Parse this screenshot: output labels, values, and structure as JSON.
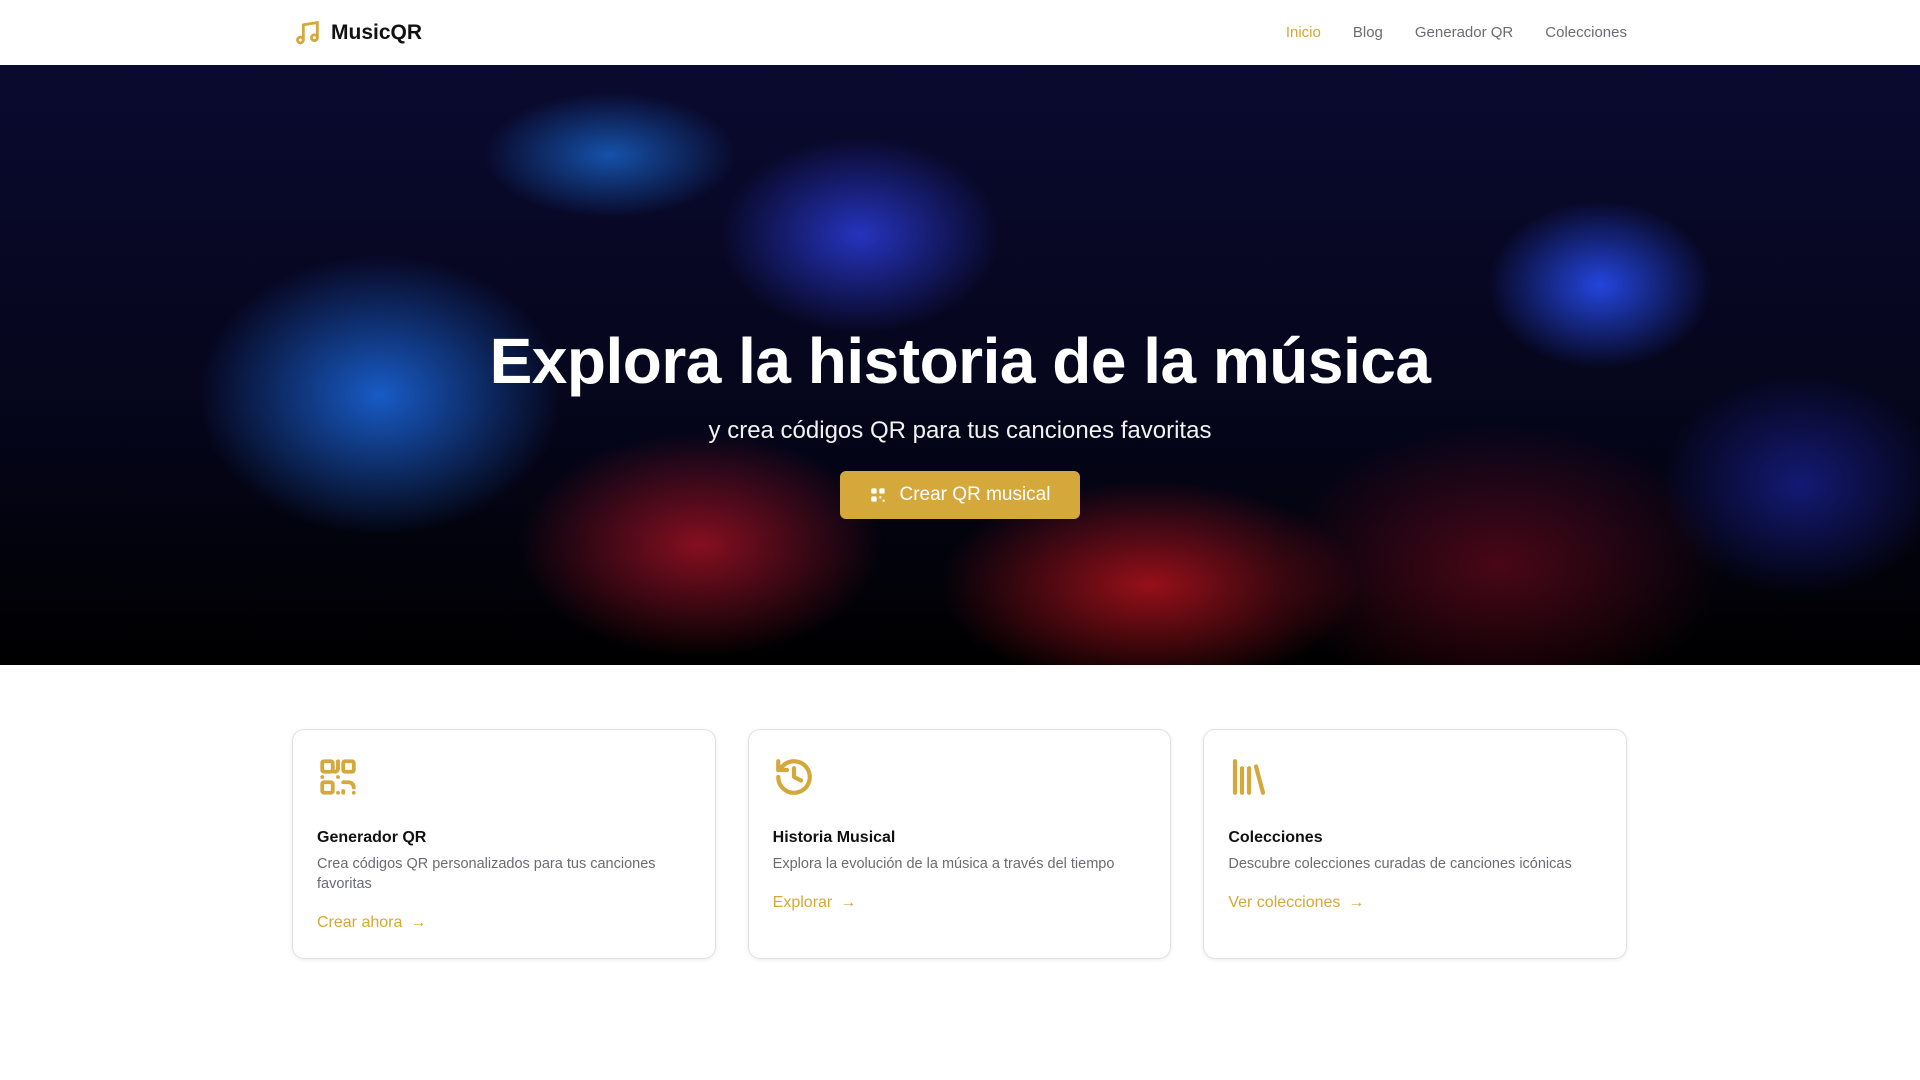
{
  "brand": {
    "name": "MusicQR",
    "accent": "#d4a83a"
  },
  "nav": {
    "items": [
      {
        "label": "Inicio",
        "active": true
      },
      {
        "label": "Blog"
      },
      {
        "label": "Generador QR"
      },
      {
        "label": "Colecciones"
      }
    ]
  },
  "hero": {
    "title": "Explora la historia de la música",
    "subtitle": "y crea códigos QR para tus canciones favoritas",
    "cta": "Crear QR musical"
  },
  "cards": [
    {
      "icon": "qr-code-icon",
      "title": "Generador QR",
      "desc": "Crea códigos QR personalizados para tus canciones favoritas",
      "link": "Crear ahora"
    },
    {
      "icon": "history-icon",
      "title": "Historia Musical",
      "desc": "Explora la evolución de la música a través del tiempo",
      "link": "Explorar"
    },
    {
      "icon": "library-icon",
      "title": "Colecciones",
      "desc": "Descubre colecciones curadas de canciones icónicas",
      "link": "Ver colecciones"
    }
  ]
}
